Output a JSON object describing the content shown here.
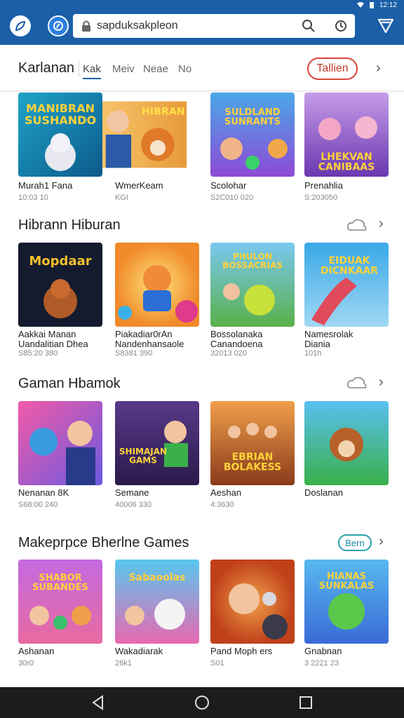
{
  "status_bar": {
    "time_text": "12:12"
  },
  "browser": {
    "url_text": "sapduksakpleon"
  },
  "tabs": {
    "title": "Karlanan",
    "items": [
      {
        "label": "Kak",
        "active": true
      },
      {
        "label": "Meiv",
        "active": false
      },
      {
        "label": "Neae",
        "active": false
      },
      {
        "label": "No",
        "active": false
      }
    ],
    "pill_label": "Tallien"
  },
  "sections": [
    {
      "title": "",
      "items": [
        {
          "name": "Murah1 Fana",
          "meta": "10:03 10",
          "art": "MANIBRAN\nSUSHANDO"
        },
        {
          "name": "WmerKeam",
          "meta": "KGI",
          "art": "HIBRAN"
        },
        {
          "name": "Scolohar",
          "meta": "S2C010 020",
          "art": "SULDLAND\nSUNRANTS"
        },
        {
          "name": "Prenahlia",
          "meta": "S:203050",
          "art": "LHEKVAN\nCANIBAAS"
        }
      ]
    },
    {
      "title": "Hibrann Hiburan",
      "items": [
        {
          "name": "Aakkai Manan",
          "name2": "Uandalitian Dhea",
          "meta": "S85:20 380",
          "art": "Mopdaar"
        },
        {
          "name": "Piakadiar0rAn",
          "name2": "Nandenhansaole",
          "meta": "S8381 390",
          "art": ""
        },
        {
          "name": "Bossolanaka",
          "name2": "Canandoena",
          "meta": "32013 020",
          "art": "PHULON\nBOSSACRIAS"
        },
        {
          "name": "Namesrolak",
          "name2": "Diania",
          "meta": "101h",
          "art": "EIDUAK\nDICNKAAR"
        }
      ]
    },
    {
      "title": "Gaman Hbamok",
      "items": [
        {
          "name": "Nenanan 8K",
          "meta": "S68:00 240",
          "art": ""
        },
        {
          "name": "Semane",
          "meta": "40006 330",
          "art": "SHIMAJAN\nGAMS"
        },
        {
          "name": "Aeshan",
          "meta": "4:3630",
          "art": "EBRIAN\nBOLAKESS"
        },
        {
          "name": "Doslanan",
          "meta": "",
          "art": ""
        }
      ]
    },
    {
      "title": "Makeprpce Bherlne Games",
      "pill": "Bern",
      "items": [
        {
          "name": "Ashanan",
          "meta": "30r0",
          "art": "SHABOR\nSUBANDES"
        },
        {
          "name": "Wakadiarak",
          "meta": "26k1",
          "art": "Sabaoolas"
        },
        {
          "name": "Pand Moph ers",
          "meta": "S01",
          "art": ""
        },
        {
          "name": "Gnabnan",
          "meta": "3 2221 23",
          "art": "HIANAS\nSUNKALAS"
        }
      ]
    }
  ],
  "colors": {
    "brand": "#1a5fa8",
    "pill_red": "#d9443a",
    "pill_teal": "#29a0b0"
  }
}
